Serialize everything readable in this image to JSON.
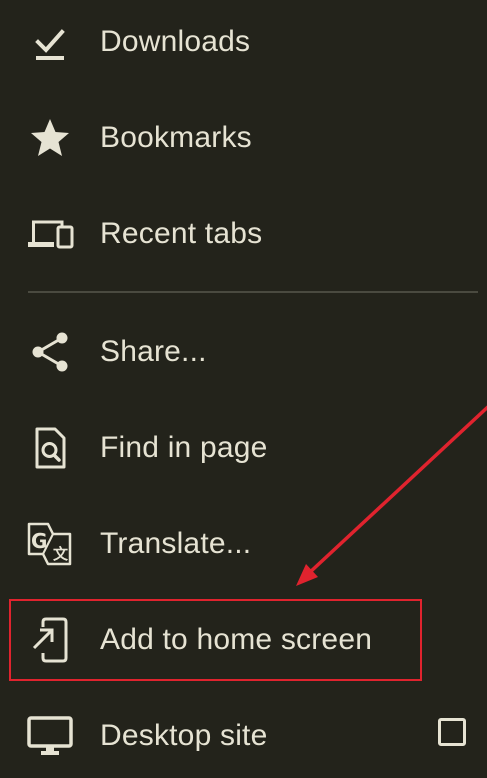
{
  "menu": {
    "items": [
      {
        "label": "Downloads",
        "icon": "download-done-icon"
      },
      {
        "label": "Bookmarks",
        "icon": "star-icon"
      },
      {
        "label": "Recent tabs",
        "icon": "devices-icon"
      },
      {
        "label": "Share...",
        "icon": "share-icon"
      },
      {
        "label": "Find in page",
        "icon": "find-in-page-icon"
      },
      {
        "label": "Translate...",
        "icon": "translate-icon"
      },
      {
        "label": "Add to home screen",
        "icon": "add-to-home-screen-icon"
      },
      {
        "label": "Desktop site",
        "icon": "desktop-icon",
        "checked": false
      }
    ]
  },
  "colors": {
    "background": "#23231b",
    "text": "#e6e3d3",
    "divider": "#4a4a40",
    "annotation": "#e0232e"
  }
}
